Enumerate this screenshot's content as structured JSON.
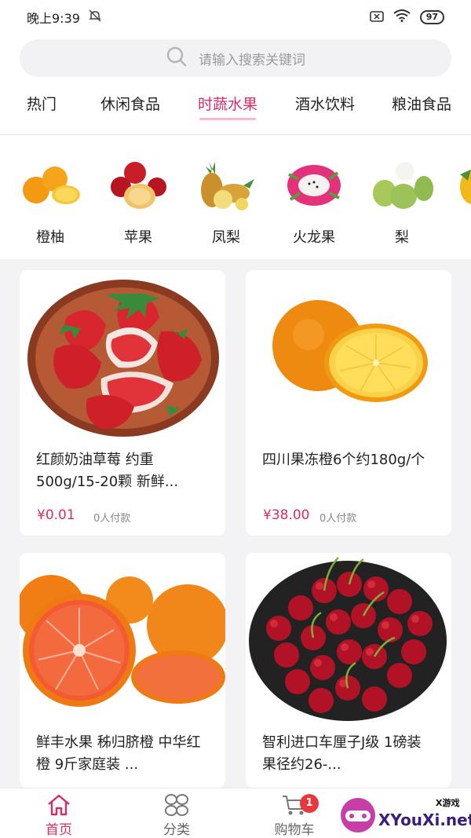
{
  "status_bar": {
    "time": "晚上9:39",
    "battery": "97"
  },
  "search": {
    "placeholder": "请输入搜索关键词"
  },
  "tabs": [
    {
      "label": "热门"
    },
    {
      "label": "休闲食品"
    },
    {
      "label": "时蔬水果",
      "active": true
    },
    {
      "label": "酒水饮料"
    },
    {
      "label": "粮油食品"
    }
  ],
  "categories": [
    {
      "label": "橙柚",
      "icon": "orange-icon"
    },
    {
      "label": "苹果",
      "icon": "apple-icon"
    },
    {
      "label": "凤梨",
      "icon": "pineapple-icon"
    },
    {
      "label": "火龙果",
      "icon": "dragonfruit-icon"
    },
    {
      "label": "梨",
      "icon": "pear-icon"
    }
  ],
  "products": [
    {
      "title": "红颜奶油草莓 约重500g/15-20颗 新鲜...",
      "price": "¥0.01",
      "sold": "0人付款",
      "image": "strawberry-image"
    },
    {
      "title": "四川果冻橙6个约180g/个",
      "price": "¥38.00",
      "sold": "0人付款",
      "image": "orange-image"
    },
    {
      "title": "鲜丰水果 秭归脐橙 中华红橙 9斤家庭装 ...",
      "price": "",
      "sold": "",
      "image": "blood-orange-image"
    },
    {
      "title": "智利进口车厘子J级 1磅装 果径约26-...",
      "price": "",
      "sold": "",
      "image": "cherry-image"
    }
  ],
  "bottom_nav": [
    {
      "label": "首页",
      "icon": "home-icon",
      "active": true
    },
    {
      "label": "分类",
      "icon": "category-icon"
    },
    {
      "label": "购物车",
      "icon": "cart-icon",
      "badge": "1"
    }
  ],
  "watermark": {
    "text": "XYouXi.net",
    "small": "X游戏"
  },
  "colors": {
    "accent": "#d62c6b",
    "badge": "#e8383d",
    "background": "#f3f3f5"
  }
}
